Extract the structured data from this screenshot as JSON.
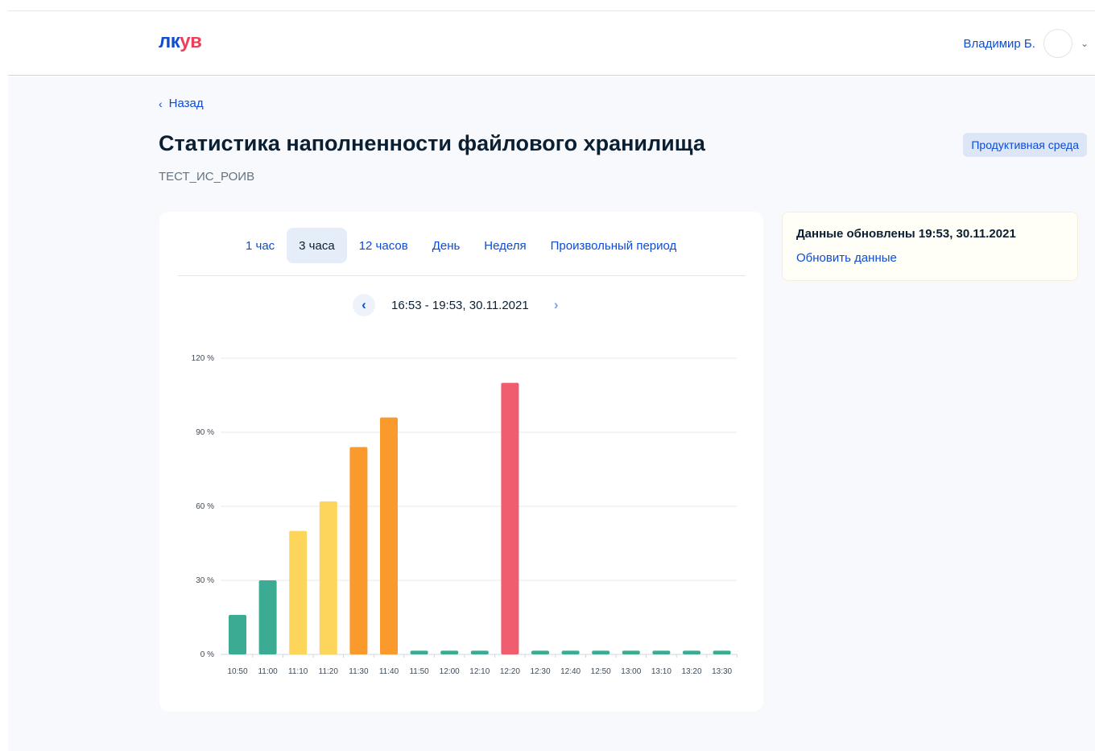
{
  "header": {
    "logo_part1": "лк",
    "logo_part2": "ув",
    "user_name": "Владимир Б."
  },
  "page": {
    "back_label": "Назад",
    "title": "Статистика наполненности файлового хранилища",
    "subtitle": "ТЕСТ_ИС_РОИВ",
    "env_badge": "Продуктивная среда"
  },
  "tabs": [
    {
      "label": "1 час",
      "active": false
    },
    {
      "label": "3 часа",
      "active": true
    },
    {
      "label": "12 часов",
      "active": false
    },
    {
      "label": "День",
      "active": false
    },
    {
      "label": "Неделя",
      "active": false
    },
    {
      "label": "Произвольный период",
      "active": false
    }
  ],
  "period": {
    "range": "16:53 - 19:53, 30.11.2021"
  },
  "info": {
    "updated": "Данные обновлены 19:53, 30.11.2021",
    "refresh_label": "Обновить данные"
  },
  "colors": {
    "green": "#3bac93",
    "yellow": "#fdd55a",
    "orange": "#fa9a2d",
    "red": "#ef5d6f",
    "accent": "#0d4cd3"
  },
  "chart_data": {
    "type": "bar",
    "categories": [
      "10:50",
      "11:00",
      "11:10",
      "11:20",
      "11:30",
      "11:40",
      "11:50",
      "12:00",
      "12:10",
      "12:20",
      "12:30",
      "12:40",
      "12:50",
      "13:00",
      "13:10",
      "13:20",
      "13:30"
    ],
    "values": [
      16,
      30,
      50,
      62,
      84,
      96,
      1.5,
      1.5,
      1.5,
      110,
      1.5,
      1.5,
      1.5,
      1.5,
      1.5,
      1.5,
      1.5
    ],
    "bar_colors": [
      "green",
      "green",
      "yellow",
      "yellow",
      "orange",
      "orange",
      "green",
      "green",
      "green",
      "red",
      "green",
      "green",
      "green",
      "green",
      "green",
      "green",
      "green"
    ],
    "yticks": [
      "0 %",
      "30 %",
      "60 %",
      "90 %",
      "120 %"
    ],
    "ytick_values": [
      0,
      30,
      60,
      90,
      120
    ],
    "ylim": [
      0,
      120
    ],
    "grid": true
  }
}
